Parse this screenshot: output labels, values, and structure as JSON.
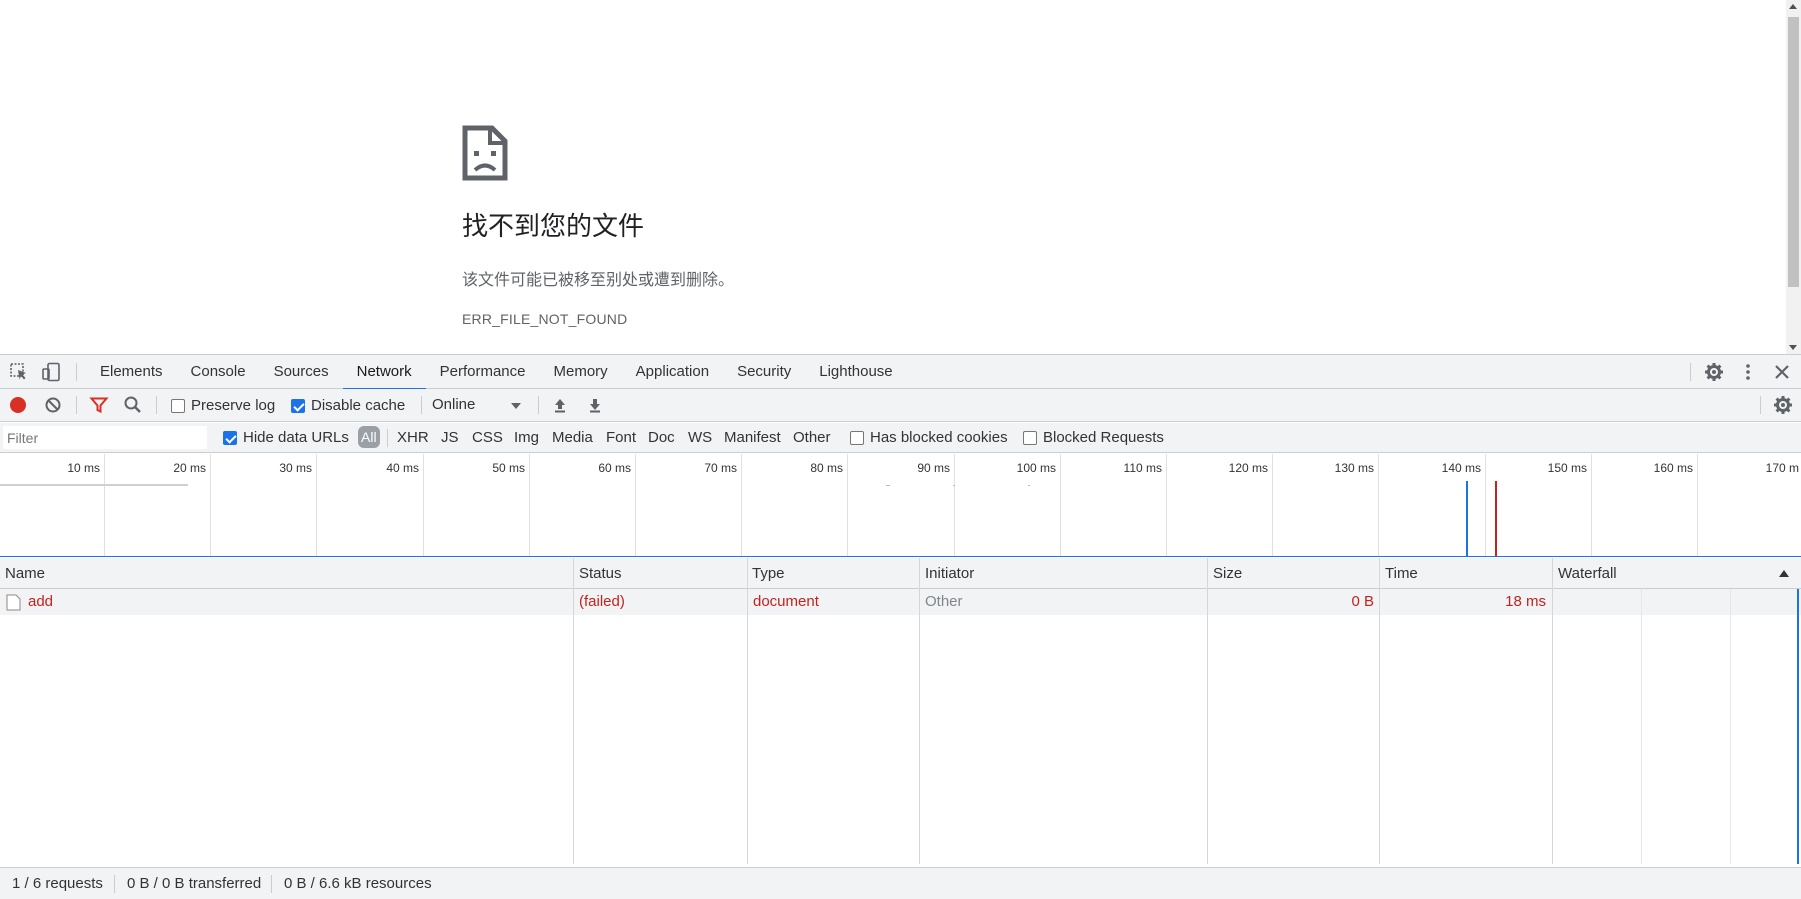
{
  "page": {
    "title": "找不到您的文件",
    "description": "该文件可能已被移至别处或遭到删除。",
    "error_code": "ERR_FILE_NOT_FOUND",
    "icon": "sad-document-icon"
  },
  "devtools": {
    "tabs": [
      "Elements",
      "Console",
      "Sources",
      "Network",
      "Performance",
      "Memory",
      "Application",
      "Security",
      "Lighthouse"
    ],
    "active_tab": "Network",
    "toolbar": {
      "preserve_log": {
        "label": "Preserve log",
        "checked": false
      },
      "disable_cache": {
        "label": "Disable cache",
        "checked": true
      },
      "throttling": "Online"
    },
    "filter": {
      "placeholder": "Filter",
      "hide_data_urls": {
        "label": "Hide data URLs",
        "checked": true
      },
      "types": [
        "All",
        "XHR",
        "JS",
        "CSS",
        "Img",
        "Media",
        "Font",
        "Doc",
        "WS",
        "Manifest",
        "Other"
      ],
      "active_type": "All",
      "has_blocked_cookies": {
        "label": "Has blocked cookies",
        "checked": false
      },
      "blocked_requests": {
        "label": "Blocked Requests",
        "checked": false
      }
    },
    "overview": {
      "tick_labels": [
        "10 ms",
        "20 ms",
        "30 ms",
        "40 ms",
        "50 ms",
        "60 ms",
        "70 ms",
        "80 ms",
        "90 ms",
        "100 ms",
        "110 ms",
        "120 ms",
        "130 ms",
        "140 ms",
        "150 ms",
        "160 ms",
        "170 m"
      ],
      "dom_content_loaded_color": "#1a73e8",
      "load_color": "#c5221f"
    },
    "table": {
      "columns": [
        "Name",
        "Status",
        "Type",
        "Initiator",
        "Size",
        "Time",
        "Waterfall"
      ],
      "rows": [
        {
          "name": "add",
          "status": "(failed)",
          "type": "document",
          "initiator": "Other",
          "size": "0 B",
          "time": "18 ms"
        }
      ]
    },
    "status": {
      "requests": "1 / 6 requests",
      "transferred": "0 B / 0 B transferred",
      "resources": "0 B / 6.6 kB resources"
    }
  }
}
